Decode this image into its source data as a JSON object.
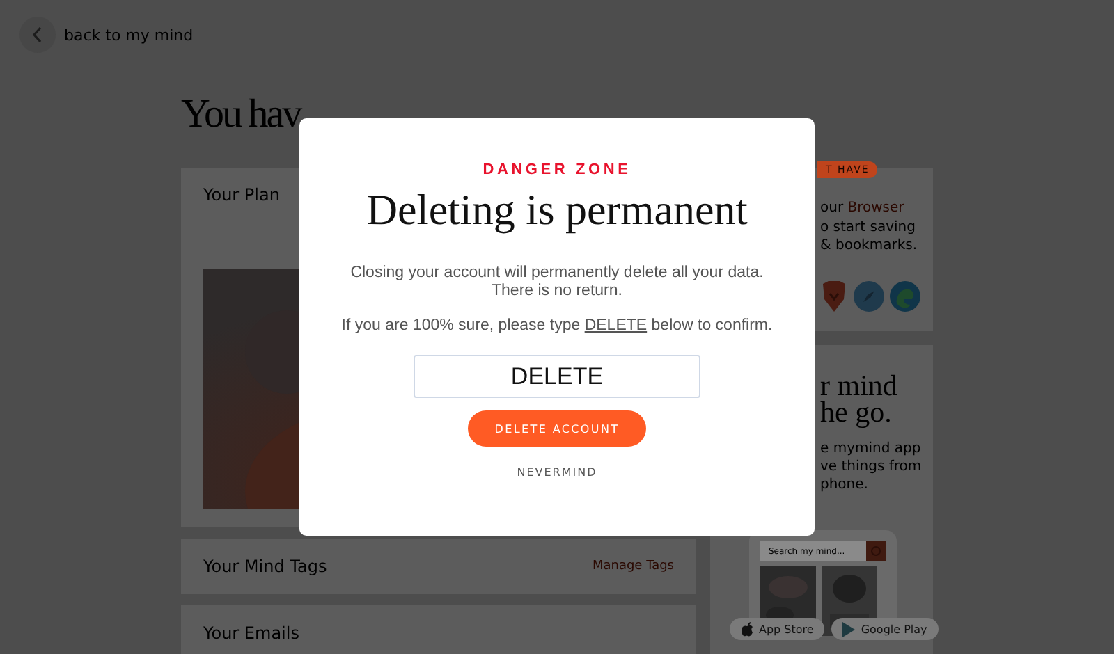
{
  "back_link": {
    "label": "back to my mind"
  },
  "heading": "You hav",
  "plan_card": {
    "title": "Your Plan",
    "kind": "picture"
  },
  "tags_card": {
    "title": "Your Mind Tags",
    "action": "Manage Tags"
  },
  "emails_card": {
    "title": "Your Emails"
  },
  "browser_card": {
    "badge": "T HAVE",
    "lead": "our",
    "link": "Browser",
    "lines": [
      "o start saving",
      "& bookmarks."
    ]
  },
  "app_card": {
    "title_lines": [
      "r mind",
      "he go."
    ],
    "lines": [
      "e mymind app",
      "ve things from",
      "phone."
    ],
    "search_placeholder": "Search my mind...",
    "store_buttons": [
      "App Store",
      "Google Play"
    ]
  },
  "modal": {
    "eyebrow": "DANGER ZONE",
    "title": "Deleting is permanent",
    "message": "Closing your account will permanently delete all your data.\nThere is no return.",
    "confirm_prefix": "If you are 100% sure, please type",
    "confirm_keyword": "DELETE",
    "confirm_suffix": "below to confirm.",
    "input": {
      "value": "DELETE"
    },
    "primary_button": "DELETE ACCOUNT",
    "secondary_button": "NEVERMIND"
  }
}
